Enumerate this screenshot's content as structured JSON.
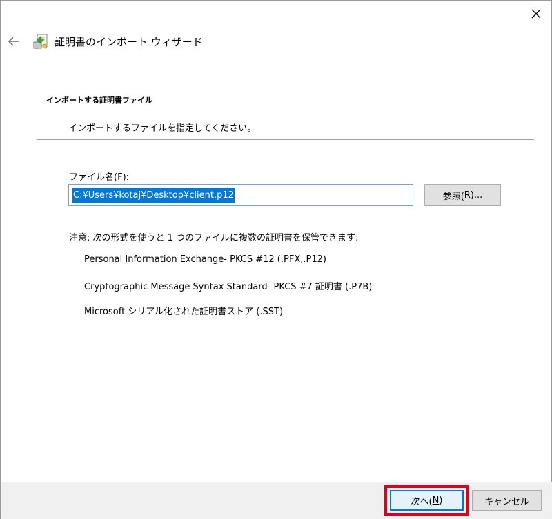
{
  "window": {
    "title": "証明書のインポート ウィザード"
  },
  "section": {
    "heading": "インポートする証明書ファイル",
    "description": "インポートするファイルを指定してください。"
  },
  "file": {
    "label_prefix": "ファイル名(",
    "label_accel": "F",
    "label_suffix": "):",
    "value": "C:¥Users¥kotaj¥Desktop¥client.p12",
    "browse_prefix": "参照(",
    "browse_accel": "R",
    "browse_suffix": ")..."
  },
  "note": "注意: 次の形式を使うと 1 つのファイルに複数の証明書を保管できます:",
  "formats": [
    "Personal Information Exchange- PKCS #12 (.PFX,.P12)",
    "Cryptographic Message Syntax Standard- PKCS #7 証明書 (.P7B)",
    "Microsoft シリアル化された証明書ストア (.SST)"
  ],
  "footer": {
    "next_prefix": "次へ(",
    "next_accel": "N",
    "next_suffix": ")",
    "cancel_label": "キャンセル"
  },
  "icons": {
    "close": "close-icon",
    "back": "back-arrow-icon",
    "wizard": "certificate-wizard-icon"
  },
  "colors": {
    "selection": "#0078d7",
    "highlight_box": "#e0001a",
    "footer_bg": "#f0f0f0"
  }
}
